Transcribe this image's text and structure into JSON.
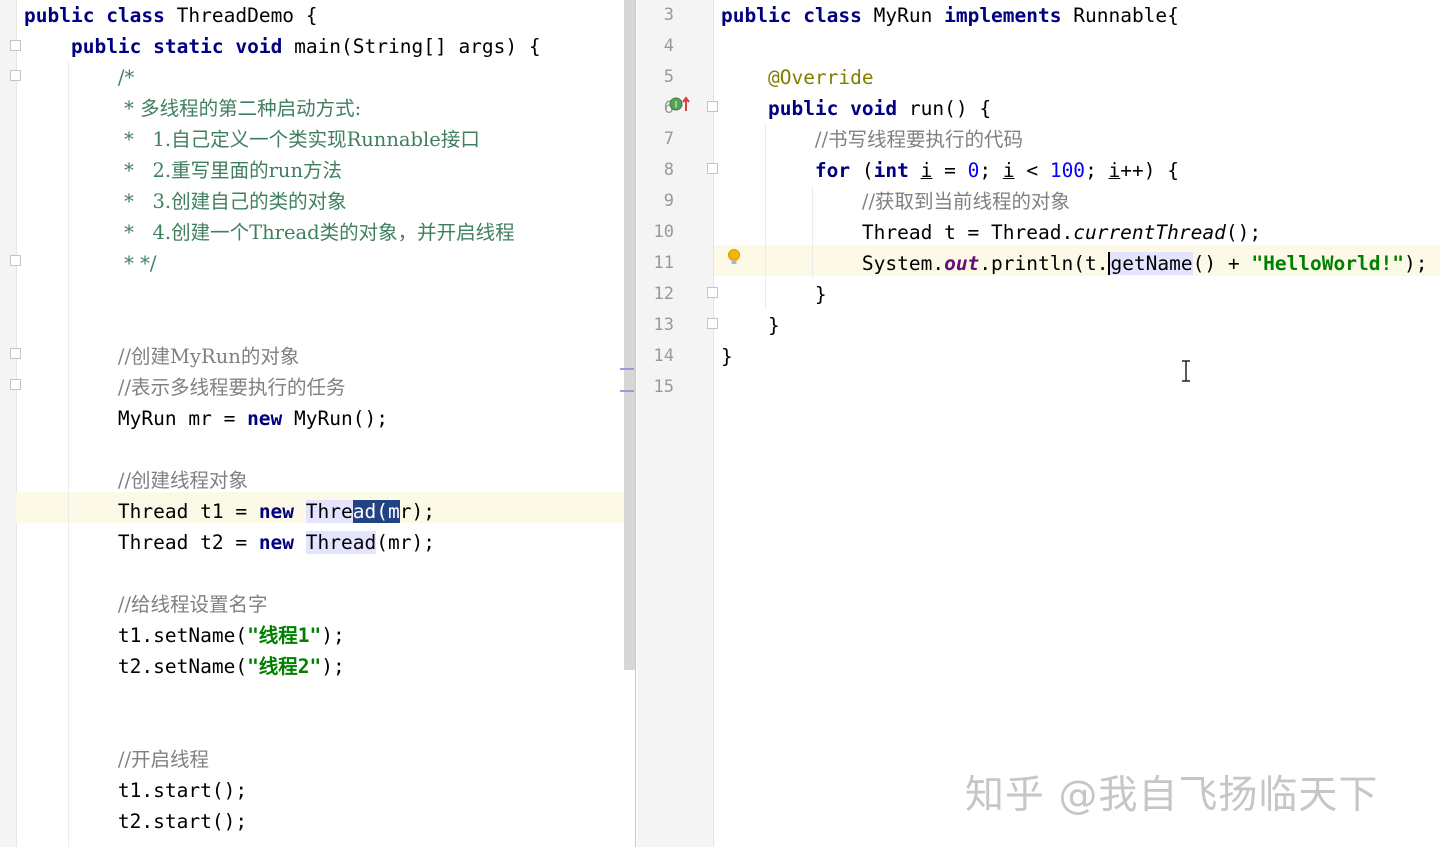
{
  "left_code": {
    "class_decl": {
      "kw1": "public",
      "kw2": "class",
      "name": " ThreadDemo {"
    },
    "main_decl": {
      "kw1": "public",
      "kw2": "static",
      "kw3": "void",
      "rest": " main(String[] args) {"
    },
    "doc_open": "/*",
    "doc_lines": [
      " * 多线程的第二种启动方式:",
      " *   1.自己定义一个类实现Runnable接口",
      " *   2.重写里面的run方法",
      " *   3.创建自己的类的对象",
      " *   4.创建一个Thread类的对象，并开启线程",
      " * */"
    ],
    "comment_create_myrun": "//创建MyRun的对象",
    "comment_task": "//表示多线程要执行的任务",
    "myrun_line": {
      "pre": "MyRun mr = ",
      "kw": "new",
      "post": " MyRun();"
    },
    "comment_create_thread": "//创建线程对象",
    "t1_line": {
      "pre": "Thread t1 = ",
      "kw": "new",
      "match": "Thre",
      "sel": "ad(m",
      "post": "r);"
    },
    "t2_line": {
      "pre": "Thread t2 = ",
      "kw": "new",
      "match": "Thread",
      "post": "(mr);"
    },
    "comment_set_name": "//给线程设置名字",
    "set_name_1": {
      "pre": "t1.setName(",
      "str": "\"线程1\"",
      "post": ");"
    },
    "set_name_2": {
      "pre": "t2.setName(",
      "str": "\"线程2\"",
      "post": ");"
    },
    "comment_start": "//开启线程",
    "start_1": "t1.start();",
    "start_2": "t2.start();"
  },
  "right_code": {
    "line_numbers": [
      "3",
      "4",
      "5",
      "6",
      "7",
      "8",
      "9",
      "10",
      "11",
      "12",
      "13",
      "14",
      "15"
    ],
    "class_decl": {
      "kw1": "public",
      "kw2": "class",
      "name": " MyRun ",
      "kw3": "implements",
      "rest": " Runnable{"
    },
    "annotation": "@Override",
    "run_decl": {
      "kw1": "public",
      "kw2": "void",
      "rest": " run() {"
    },
    "comment_code": "//书写线程要执行的代码",
    "for_line": {
      "kw": "for",
      "p1": " (",
      "kw2": "int",
      "v1": "i",
      "p2": " = ",
      "n1": "0",
      "p3": "; ",
      "v2": "i",
      "p4": " < ",
      "n2": "100",
      "p5": "; ",
      "v3": "i",
      "p6": "++) {"
    },
    "comment_get_thread": "//获取到当前线程的对象",
    "thread_line": {
      "pre": "Thread t = Thread.",
      "method": "currentThread",
      "post": "();"
    },
    "println_line": {
      "pre": "System.",
      "field": "out",
      "mid": ".println(t.",
      "method": "getName",
      "post": "() + ",
      "str": "\"HelloWorld!\"",
      "end": ");"
    },
    "close_for": "}",
    "close_run": "}",
    "close_class": "}"
  },
  "icons": {
    "override": "override-gutter-icon",
    "bulb": "lightbulb-icon",
    "cursor": "text-cursor-icon"
  },
  "watermark": "知乎 @我自飞扬临天下"
}
